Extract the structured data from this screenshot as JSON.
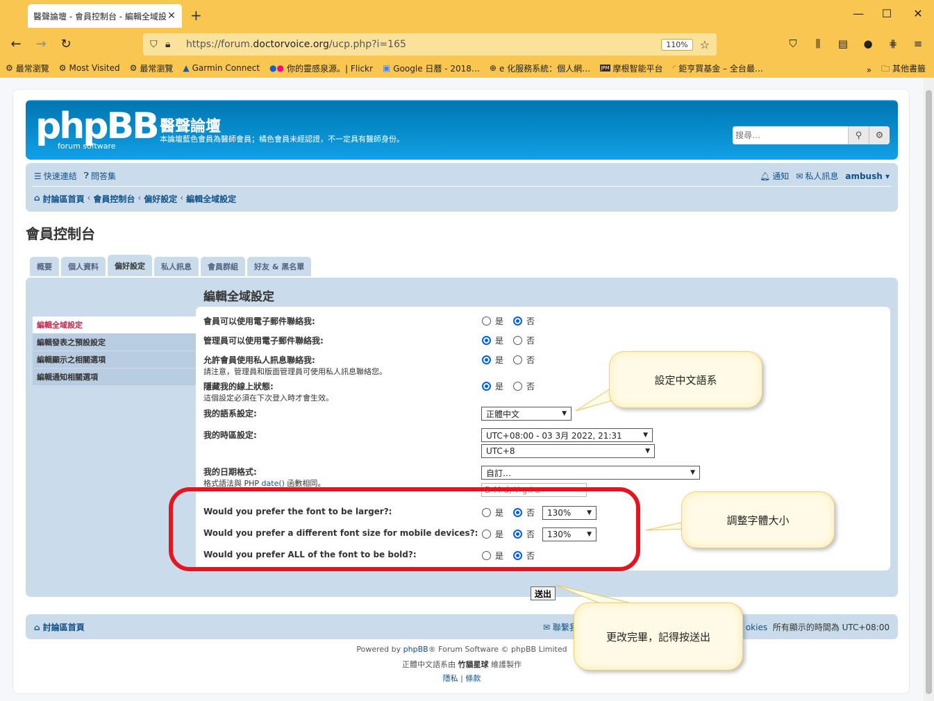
{
  "browser": {
    "tab_title": "醫聲論壇 - 會員控制台 - 編輯全域設",
    "url_prefix": "https://forum.",
    "url_domain": "doctorvoice.org",
    "url_path": "/ucp.php?i=165",
    "zoom": "110%",
    "bookmarks": [
      {
        "label": "最常瀏覽",
        "icon": "gear-icon"
      },
      {
        "label": "Most Visited",
        "icon": "gear-icon"
      },
      {
        "label": "最常瀏覽",
        "icon": "gear-icon"
      },
      {
        "label": "Garmin Connect",
        "icon": "triangle-icon"
      },
      {
        "label": "你的靈感泉源。| Flickr",
        "icon": "flickr-icon"
      },
      {
        "label": "Google 日曆 - 2018…",
        "icon": "calendar-icon"
      },
      {
        "label": "e 化服務系統：個人網…",
        "icon": "globe-icon"
      },
      {
        "label": "摩根智能平台",
        "icon": "jpm-icon"
      },
      {
        "label": "鉅亨買基金 – 全台最…",
        "icon": "rainbow-icon"
      }
    ],
    "other_bookmarks": "其他書籤"
  },
  "forum": {
    "logo_text": "phpBB",
    "logo_sub": "forum software",
    "site_title": "醫聲論壇",
    "site_desc": "本論壇藍色會員為醫師會員；橘色會員未經認證，不一定具有醫師身份。",
    "search_placeholder": "搜尋…"
  },
  "nav": {
    "quick_links": "快速連結",
    "faq": "問答集",
    "notifications": "通知",
    "private_messages": "私人訊息",
    "username": "ambush",
    "breadcrumbs": [
      "討論區首頁",
      "會員控制台",
      "偏好設定",
      "編輯全域設定"
    ]
  },
  "ucp": {
    "title": "會員控制台",
    "tabs": [
      "概要",
      "個人資料",
      "偏好設定",
      "私人訊息",
      "會員群組",
      "好友 & 黑名單"
    ],
    "menu": [
      "編輯全域設定",
      "編輯發表之預設設定",
      "編輯顯示之相關選項",
      "編輯通知相關選項"
    ],
    "heading": "編輯全域設定",
    "yes": "是",
    "no": "否",
    "rows": {
      "email_users": "會員可以使用電子郵件聯絡我:",
      "email_admin": "管理員可以使用電子郵件聯絡我:",
      "allow_pm": "允許會員使用私人訊息聯絡我:",
      "allow_pm_note": "請注意，管理員和版面管理員可使用私人訊息聯絡您。",
      "hide_online": "隱藏我的線上狀態:",
      "hide_online_note": "這個設定必須在下次登入時才會生效。",
      "language": "我的語系設定:",
      "language_value": "正體中文",
      "timezone": "我的時區設定:",
      "timezone_date": "UTC+08:00 - 03 3月 2022, 21:31",
      "timezone_zone": "UTC+8",
      "date_format": "我的日期格式:",
      "date_format_note_a": "格式語法與 PHP ",
      "date_format_note_link": "date()",
      "date_format_note_b": " 函數相同。",
      "date_format_value": "自訂…",
      "date_format_custom": "D M d, Y g:i a",
      "font_larger": "Would you prefer the font to be larger?:",
      "font_mobile": "Would you prefer a different font size for mobile devices?:",
      "font_bold": "Would you prefer ALL of the font to be bold?:",
      "font_size_value": "130%",
      "mobile_size_value": "130%"
    },
    "submit": "送出"
  },
  "footer": {
    "home": "討論區首頁",
    "contact": "聯繫我",
    "cookies": "okies",
    "tz_text": "所有顯示的時間為 UTC+08:00",
    "powered_a": "Powered by ",
    "powered_link": "phpBB",
    "powered_b": "® Forum Software © phpBB Limited",
    "translation_a": "正體中文語系由 ",
    "translation_link": "竹貓星球",
    "translation_b": " 維護製作",
    "privacy": "隱私",
    "terms": "條款"
  },
  "annotations": {
    "callout_language": "設定中文語系",
    "callout_font": "調整字體大小",
    "callout_submit": "更改完畢，記得按送出"
  }
}
